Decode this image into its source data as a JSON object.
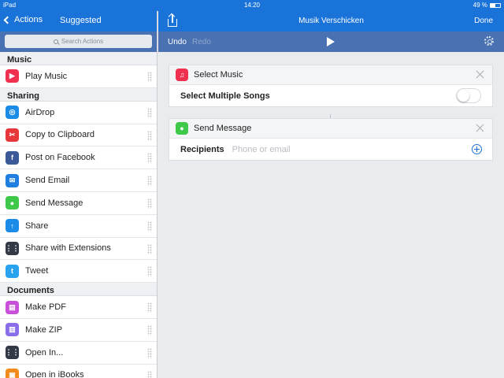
{
  "status_bar": {
    "device": "iPad",
    "time": "14:20",
    "battery_text": "49 %",
    "battery_level": 0.49
  },
  "left_panel": {
    "back_label": "Actions",
    "title": "Suggested",
    "search_placeholder": "Search Actions",
    "sections": [
      {
        "title": "Music",
        "items": [
          {
            "label": "Play Music",
            "icon": "play-music-icon",
            "color": "#f0304f",
            "glyph": "▶"
          }
        ]
      },
      {
        "title": "Sharing",
        "items": [
          {
            "label": "AirDrop",
            "icon": "airdrop-icon",
            "color": "#1a8ce8",
            "glyph": "◎"
          },
          {
            "label": "Copy to Clipboard",
            "icon": "clipboard-icon",
            "color": "#e8373a",
            "glyph": "✂"
          },
          {
            "label": "Post on Facebook",
            "icon": "facebook-icon",
            "color": "#3b5998",
            "glyph": "f"
          },
          {
            "label": "Send Email",
            "icon": "email-icon",
            "color": "#1e7fe0",
            "glyph": "✉"
          },
          {
            "label": "Send Message",
            "icon": "message-icon",
            "color": "#3ec94a",
            "glyph": "●"
          },
          {
            "label": "Share",
            "icon": "share-icon",
            "color": "#1a8ce8",
            "glyph": "↑"
          },
          {
            "label": "Share with Extensions",
            "icon": "extensions-icon",
            "color": "#333a46",
            "glyph": "⋮⋮"
          },
          {
            "label": "Tweet",
            "icon": "twitter-icon",
            "color": "#2aa3ef",
            "glyph": "t"
          }
        ]
      },
      {
        "title": "Documents",
        "items": [
          {
            "label": "Make PDF",
            "icon": "pdf-icon",
            "color": "#c84fd8",
            "glyph": "▤"
          },
          {
            "label": "Make ZIP",
            "icon": "zip-icon",
            "color": "#8a6de8",
            "glyph": "▥"
          },
          {
            "label": "Open In...",
            "icon": "open-in-icon",
            "color": "#333a46",
            "glyph": "⋮⋮"
          },
          {
            "label": "Open in iBooks",
            "icon": "ibooks-icon",
            "color": "#f28a1c",
            "glyph": "▣"
          }
        ]
      }
    ]
  },
  "right_panel": {
    "workflow_title": "Musik Verschicken",
    "done_label": "Done",
    "undo_label": "Undo",
    "redo_label": "Redo",
    "actions": [
      {
        "title": "Select Music",
        "icon": "music-icon",
        "icon_color": "#f0304f",
        "glyph": "♫",
        "field_label": "Select Multiple Songs",
        "toggle_on": false
      },
      {
        "title": "Send Message",
        "icon": "message-icon",
        "icon_color": "#3ec94a",
        "glyph": "●",
        "field_label": "Recipients",
        "field_placeholder": "Phone or email",
        "field_value": ""
      }
    ]
  },
  "colors": {
    "nav_blue": "#1a73d9",
    "toolbar_blue": "#4a71b1"
  }
}
